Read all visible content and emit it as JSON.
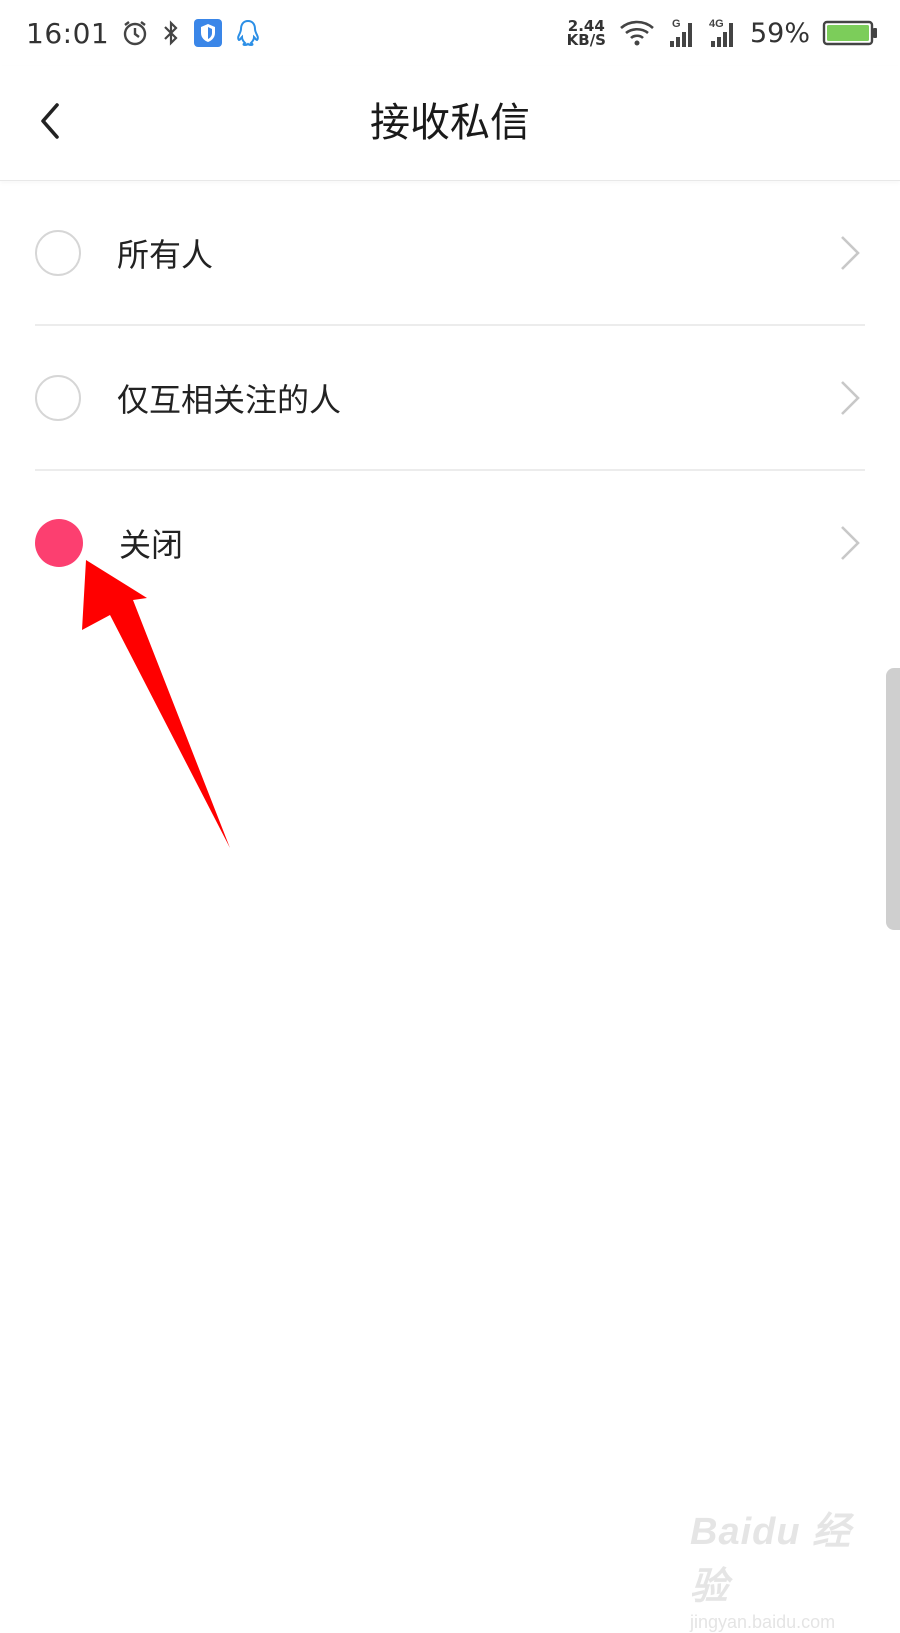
{
  "status_bar": {
    "time": "16:01",
    "net_speed_value": "2.44",
    "net_speed_unit": "KB/S",
    "battery_percent": "59%",
    "battery_color": "#7ccd5a",
    "icons": [
      "alarm-icon",
      "bluetooth-icon",
      "shield-icon",
      "qq-icon",
      "wifi-icon",
      "signal-icon",
      "signal-4g-icon",
      "battery-icon"
    ]
  },
  "header": {
    "title": "接收私信"
  },
  "options": [
    {
      "label": "所有人",
      "selected": false
    },
    {
      "label": "仅互相关注的人",
      "selected": false
    },
    {
      "label": "关闭",
      "selected": true
    }
  ],
  "colors": {
    "accent": "#fc3f70",
    "annotation_arrow": "#ff0000"
  },
  "watermark": {
    "brand": "Baidu 经验",
    "url": "jingyan.baidu.com"
  }
}
